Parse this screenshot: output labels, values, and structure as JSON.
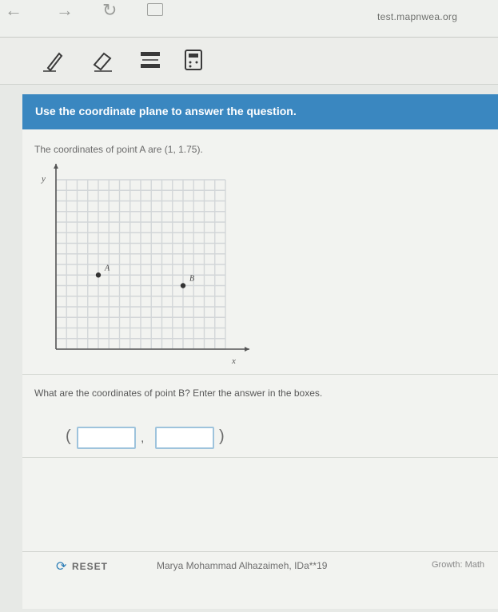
{
  "browser": {
    "url": "test.mapnwea.org",
    "back_icon": "arrow-left-icon",
    "forward_icon": "arrow-right-icon",
    "reload_icon": "reload-icon",
    "tab_icon": "tab-icon"
  },
  "toolbar": {
    "tools": [
      "pencil-icon",
      "eraser-icon",
      "line-reader-icon",
      "calculator-icon"
    ]
  },
  "question": {
    "instruction": "Use the coordinate plane to answer the question.",
    "given_text": "The coordinates of point A are (1, 1.75).",
    "prompt": "What are the coordinates of point B? Enter the answer in the boxes.",
    "open_paren": "(",
    "comma": ",",
    "close_paren": ")",
    "answer_x": "",
    "answer_y": ""
  },
  "chart_data": {
    "type": "scatter",
    "xlabel": "x",
    "ylabel": "y",
    "points": [
      {
        "label": "A",
        "x": 1,
        "y": 1.75
      },
      {
        "label": "B",
        "x": 3,
        "y": 1.5
      }
    ],
    "xlim": [
      0,
      4
    ],
    "ylim": [
      0,
      4
    ],
    "grid": true,
    "grid_divisions": 16
  },
  "footer": {
    "reset_label": "RESET",
    "author": "Marya Mohammad Alhazaimeh, IDa**19",
    "brand": "Growth: Math"
  },
  "colors": {
    "banner": "#3a87c0",
    "answer_box_border": "#9ec3dc"
  }
}
